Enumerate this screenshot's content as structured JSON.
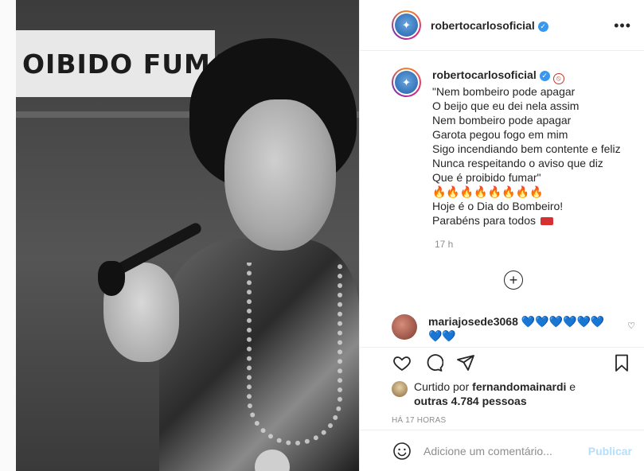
{
  "photo": {
    "sign_text": "OIBIDO FUMAR"
  },
  "post": {
    "username": "robertocarlosoficial",
    "more_icon": "more-horizontal-icon"
  },
  "caption": {
    "username": "robertocarlosoficial",
    "lines": [
      "\"Nem bombeiro pode apagar",
      "O beijo que eu dei nela assim",
      "Nem bombeiro pode apagar",
      "Garota pegou fogo em mim",
      "Sigo incendiando bem contente e feliz",
      "Nunca respeitando o aviso que diz",
      "Que é proibido fumar\"",
      "🔥🔥🔥🔥🔥🔥🔥🔥",
      "Hoje é o Dia do Bombeiro!",
      "Parabéns para todos"
    ],
    "time": "17 h"
  },
  "comment": {
    "username": "mariajosede3068",
    "text": "💙💙💙💙💙💙💙💙"
  },
  "likes": {
    "prefix": "Curtido por",
    "user": "fernandomainardi",
    "mid": "e",
    "others": "outras 4.784 pessoas"
  },
  "timestamp": "HÁ 17 HORAS",
  "add_comment": {
    "placeholder": "Adicione um comentário...",
    "publish_label": "Publicar"
  },
  "colors": {
    "verified": "#3897f0",
    "publish_disabled": "#b2dffc",
    "hearts": "#1e90ff"
  }
}
